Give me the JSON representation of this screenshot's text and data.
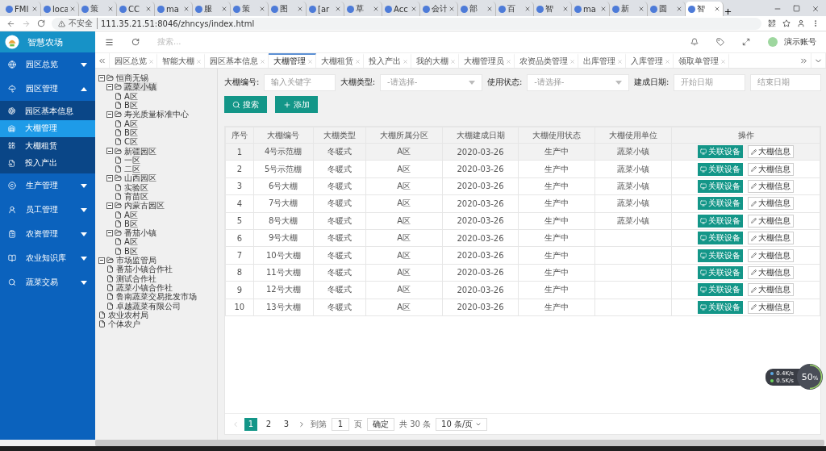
{
  "browser": {
    "tabs": [
      {
        "title": "FMI",
        "selected": false
      },
      {
        "title": "loca",
        "selected": false
      },
      {
        "title": "策",
        "selected": false
      },
      {
        "title": "CC",
        "selected": false
      },
      {
        "title": "ma",
        "selected": false
      },
      {
        "title": "服",
        "selected": false
      },
      {
        "title": "策",
        "selected": false
      },
      {
        "title": "图",
        "selected": false
      },
      {
        "title": "[ar",
        "selected": false
      },
      {
        "title": "草",
        "selected": false
      },
      {
        "title": "Acc",
        "selected": false
      },
      {
        "title": "会计",
        "selected": false
      },
      {
        "title": "部",
        "selected": false
      },
      {
        "title": "百",
        "selected": false
      },
      {
        "title": "智",
        "selected": false
      },
      {
        "title": "ma",
        "selected": false
      },
      {
        "title": "新",
        "selected": false
      },
      {
        "title": "圆",
        "selected": false
      },
      {
        "title": "智",
        "selected": true
      }
    ],
    "security": "不安全",
    "url": "111.35.21.51:8046/zhncys/index.html"
  },
  "app": {
    "title": "智慧农场",
    "search_placeholder": "搜索...",
    "user": "演示账号"
  },
  "sidebar": {
    "items": [
      {
        "label": "园区总览",
        "expanded": false,
        "selected": false
      },
      {
        "label": "园区管理",
        "expanded": true,
        "selected": false,
        "children": [
          {
            "label": "园区基本信息",
            "selected": false
          },
          {
            "label": "大棚管理",
            "selected": true
          },
          {
            "label": "大棚租赁",
            "selected": false
          },
          {
            "label": "投入产出",
            "selected": false
          }
        ]
      },
      {
        "label": "生产管理",
        "expanded": false,
        "selected": false
      },
      {
        "label": "员工管理",
        "expanded": false,
        "selected": false
      },
      {
        "label": "农资管理",
        "expanded": false,
        "selected": false
      },
      {
        "label": "农业知识库",
        "expanded": false,
        "selected": false
      },
      {
        "label": "蔬菜交易",
        "expanded": false,
        "selected": false
      }
    ]
  },
  "page_tabs": [
    {
      "label": "园区总览",
      "selected": false
    },
    {
      "label": "智能大棚",
      "selected": false
    },
    {
      "label": "园区基本信息",
      "selected": false
    },
    {
      "label": "大棚管理",
      "selected": true
    },
    {
      "label": "大棚租赁",
      "selected": false
    },
    {
      "label": "投入产出",
      "selected": false
    },
    {
      "label": "我的大棚",
      "selected": false
    },
    {
      "label": "大棚管理员",
      "selected": false
    },
    {
      "label": "农资品类管理",
      "selected": false
    },
    {
      "label": "出库管理",
      "selected": false
    },
    {
      "label": "入库管理",
      "selected": false
    },
    {
      "label": "领取单管理",
      "selected": false
    }
  ],
  "tree": [
    {
      "label": "恒商无锡",
      "expanded": true,
      "selected": false,
      "children": [
        {
          "label": "蔬菜小镇",
          "expanded": true,
          "selected": true,
          "children": [
            {
              "label": "A区",
              "selected": false
            },
            {
              "label": "B区",
              "selected": false
            }
          ]
        },
        {
          "label": "寿光质量标准中心",
          "expanded": true,
          "selected": false,
          "children": [
            {
              "label": "A区",
              "selected": false
            },
            {
              "label": "B区",
              "selected": false
            },
            {
              "label": "C区",
              "selected": false
            }
          ]
        },
        {
          "label": "新疆园区",
          "expanded": true,
          "selected": false,
          "children": [
            {
              "label": "一区",
              "selected": false
            },
            {
              "label": "二区",
              "selected": false
            }
          ]
        },
        {
          "label": "山西园区",
          "expanded": true,
          "selected": false,
          "children": [
            {
              "label": "实验区",
              "selected": false
            },
            {
              "label": "育苗区",
              "selected": false
            }
          ]
        },
        {
          "label": "内蒙古园区",
          "expanded": true,
          "selected": false,
          "children": [
            {
              "label": "A区",
              "selected": false
            },
            {
              "label": "B区",
              "selected": false
            }
          ]
        },
        {
          "label": "番茄小镇",
          "expanded": true,
          "selected": false,
          "children": [
            {
              "label": "A区",
              "selected": false
            },
            {
              "label": "B区",
              "selected": false
            }
          ]
        }
      ]
    },
    {
      "label": "市场监管局",
      "expanded": true,
      "selected": false,
      "children": [
        {
          "label": "番茄小镇合作社",
          "selected": false
        },
        {
          "label": "测试合作社",
          "selected": false
        },
        {
          "label": "蔬菜小镇合作社",
          "selected": false
        },
        {
          "label": "鲁南蔬菜交易批发市场",
          "selected": false
        },
        {
          "label": "卓越蔬菜有限公司",
          "selected": false
        }
      ]
    },
    {
      "label": "农业农村局",
      "selected": false
    },
    {
      "label": "个体农户",
      "selected": false
    }
  ],
  "filters": [
    {
      "kind": "input",
      "label": "大棚编号:",
      "placeholder": "输入关键字"
    },
    {
      "kind": "select",
      "label": "大棚类型:",
      "placeholder": "-请选择-"
    },
    {
      "kind": "select",
      "label": "使用状态:",
      "placeholder": "-请选择-"
    },
    {
      "kind": "daterange",
      "label": "建成日期:",
      "placeholder": "开始日期",
      "placeholder_end": "结束日期"
    }
  ],
  "actions": [
    "搜索",
    "添加"
  ],
  "table": {
    "columns": [
      "序号",
      "大棚编号",
      "大棚类型",
      "大棚所属分区",
      "大棚建成日期",
      "大棚使用状态",
      "大棚使用单位",
      "操作"
    ],
    "rows": [
      {
        "no": "1",
        "code": "4号示范棚",
        "type": "冬暖式",
        "zone": "A区",
        "date": "2020-03-26",
        "status": "生产中",
        "unit": "蔬菜小镇",
        "selected": true,
        "actions": [
          "关联设备",
          "大棚信息"
        ]
      },
      {
        "no": "2",
        "code": "5号示范棚",
        "type": "冬暖式",
        "zone": "A区",
        "date": "2020-03-26",
        "status": "生产中",
        "unit": "蔬菜小镇",
        "selected": false,
        "actions": [
          "关联设备",
          "大棚信息"
        ]
      },
      {
        "no": "3",
        "code": "6号大棚",
        "type": "冬暖式",
        "zone": "A区",
        "date": "2020-03-26",
        "status": "生产中",
        "unit": "蔬菜小镇",
        "selected": false,
        "actions": [
          "关联设备",
          "大棚信息"
        ]
      },
      {
        "no": "4",
        "code": "7号大棚",
        "type": "冬暖式",
        "zone": "A区",
        "date": "2020-03-26",
        "status": "生产中",
        "unit": "蔬菜小镇",
        "selected": false,
        "actions": [
          "关联设备",
          "大棚信息"
        ]
      },
      {
        "no": "5",
        "code": "8号大棚",
        "type": "冬暖式",
        "zone": "A区",
        "date": "2020-03-26",
        "status": "生产中",
        "unit": "蔬菜小镇",
        "selected": false,
        "actions": [
          "关联设备",
          "大棚信息"
        ]
      },
      {
        "no": "6",
        "code": "9号大棚",
        "type": "冬暖式",
        "zone": "A区",
        "date": "2020-03-26",
        "status": "生产中",
        "selected": false,
        "actions": [
          "关联设备",
          "大棚信息"
        ]
      },
      {
        "no": "7",
        "code": "10号大棚",
        "type": "冬暖式",
        "zone": "A区",
        "date": "2020-03-26",
        "status": "生产中",
        "selected": false,
        "actions": [
          "关联设备",
          "大棚信息"
        ]
      },
      {
        "no": "8",
        "code": "11号大棚",
        "type": "冬暖式",
        "zone": "A区",
        "date": "2020-03-26",
        "status": "生产中",
        "selected": false,
        "actions": [
          "关联设备",
          "大棚信息"
        ]
      },
      {
        "no": "9",
        "code": "12号大棚",
        "type": "冬暖式",
        "zone": "A区",
        "date": "2020-03-26",
        "status": "生产中",
        "selected": false,
        "actions": [
          "关联设备",
          "大棚信息"
        ]
      },
      {
        "no": "10",
        "code": "13号大棚",
        "type": "冬暖式",
        "zone": "A区",
        "date": "2020-03-26",
        "status": "生产中",
        "selected": false,
        "actions": [
          "关联设备",
          "大棚信息"
        ]
      }
    ]
  },
  "pagination": {
    "pages": [
      {
        "label": "1",
        "selected": true
      },
      {
        "label": "2",
        "selected": false
      },
      {
        "label": "3",
        "selected": false
      }
    ],
    "goto_label": "到第",
    "goto_value": "1",
    "page_unit": "页",
    "confirm": "确定",
    "total": "共 30 条",
    "page_size": "10 条/页"
  },
  "net_monitor": {
    "up": "0.4",
    "up_unit": "K/s",
    "down": "0.5",
    "down_unit": "K/s",
    "percent": "50",
    "percent_unit": "%",
    "level": 0.5
  }
}
